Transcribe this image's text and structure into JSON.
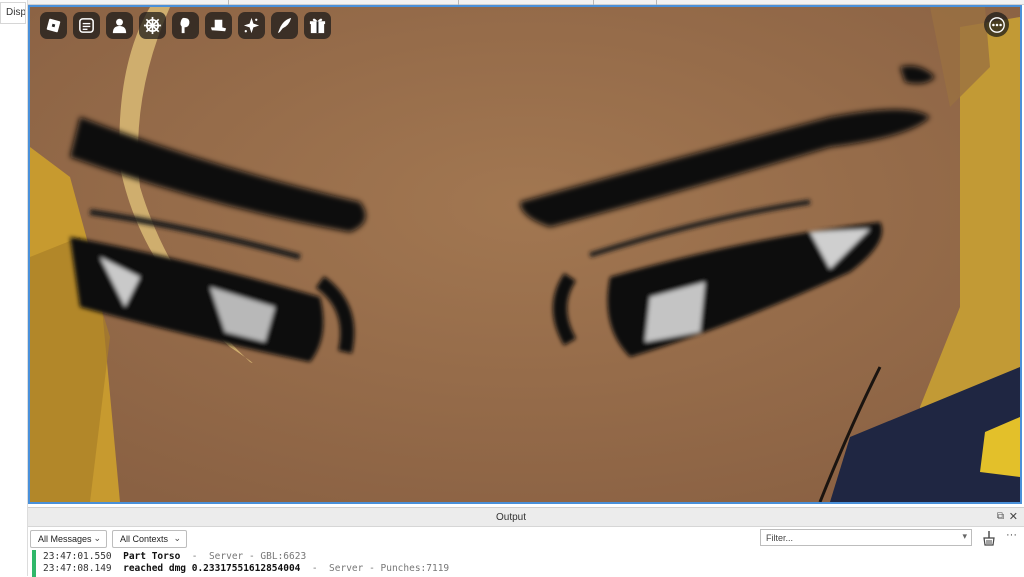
{
  "sidebar": {
    "tab_label": "Disp"
  },
  "hud": {
    "icons": [
      "roblox-logo-icon",
      "chat-icon",
      "character-icon",
      "settings-wheel-icon",
      "ability-icon",
      "hat-icon",
      "spark-icon",
      "quill-icon",
      "gift-icon"
    ],
    "menu_icon": "more-icon"
  },
  "output": {
    "title": "Output",
    "undock_glyph": "⧉",
    "close_glyph": "✕",
    "messages_filter": "All Messages",
    "contexts_filter": "All Contexts",
    "filter_placeholder": "Filter...",
    "more_glyph": "···",
    "accent_color": "#2fb86a",
    "logs": [
      {
        "time": "23:47:01.550",
        "message": "Part Torso",
        "sep": "-",
        "source": "Server - GBL:6623"
      },
      {
        "time": "23:47:08.149",
        "message": "reached dmg 0.23317551612854004",
        "sep": "-",
        "source": "Server - Punches:7119"
      }
    ]
  }
}
